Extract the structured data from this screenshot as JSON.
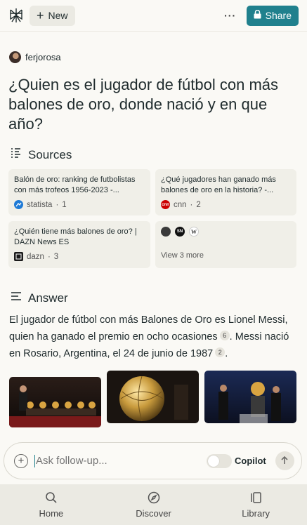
{
  "header": {
    "new_label": "New",
    "more_label": "···",
    "share_label": "Share"
  },
  "user": {
    "name": "ferjorosa"
  },
  "question": "¿Quien es el jugador de fútbol con más balones de oro, donde nació y en que año?",
  "sources": {
    "heading": "Sources",
    "cards": [
      {
        "title": "Balón de oro: ranking de futbolistas con más trofeos 1956-2023 -...",
        "site": "statista",
        "num": "1",
        "favicon_color": "#1e7ad6",
        "icon": "statista-icon"
      },
      {
        "title": "¿Qué jugadores han ganado más balones de oro en la historia? -...",
        "site": "cnn",
        "num": "2",
        "favicon_color": "#cc0000",
        "icon": "cnn-icon"
      },
      {
        "title": "¿Quién tiene más balones de oro? | DAZN News ES",
        "site": "dazn",
        "num": "3",
        "favicon_color": "#1a1a1a",
        "icon": "dazn-icon"
      }
    ],
    "view_more": "View 3 more"
  },
  "answer": {
    "heading": "Answer",
    "line1": "El jugador de fútbol con más Balones de Oro es Lionel Messi, quien ha ganado el premio en ocho ocasiones",
    "cite1": "6",
    "line2": "Messi nació en Rosario, Argentina, el 24 de junio de 1987",
    "cite2": "2"
  },
  "followup": {
    "placeholder": "Ask follow-up...",
    "copilot_label": "Copilot"
  },
  "nav": {
    "home": "Home",
    "discover": "Discover",
    "library": "Library"
  },
  "colors": {
    "accent": "#20808d",
    "background": "#faf9f5",
    "card": "#f0efe8"
  }
}
